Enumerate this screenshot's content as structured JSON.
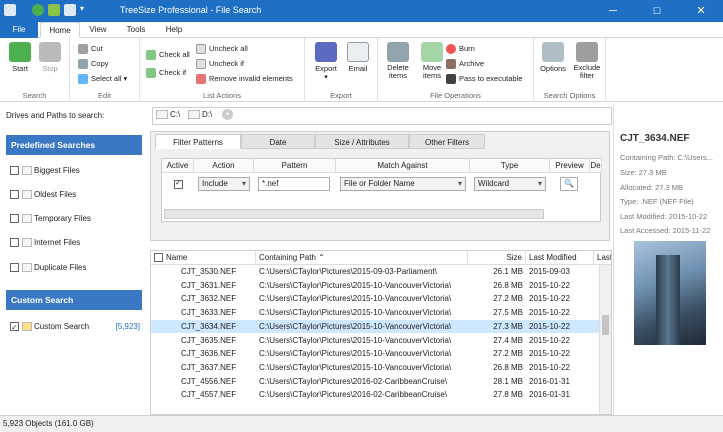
{
  "window": {
    "title": "TreeSize Professional - File Search",
    "min": "─",
    "max": "☐",
    "close": "✕"
  },
  "ribbon_tabs": [
    "File",
    "Home",
    "View",
    "Tools",
    "Help"
  ],
  "ribbon": {
    "search": {
      "start": "Start",
      "stop": "Stop",
      "label": "Search"
    },
    "edit": {
      "cut": "Cut",
      "copy": "Copy",
      "select_all": "Select all ▾",
      "label": "Edit"
    },
    "list_actions": {
      "check_all": "Check all",
      "check_if": "Check if",
      "uncheck_all": "Uncheck all",
      "uncheck_if": "Uncheck if",
      "remove_invalid": "Remove invalid elements",
      "label": "List Actions"
    },
    "export": {
      "export": "Export",
      "email": "Email",
      "label": "Export"
    },
    "file_ops": {
      "delete": "Delete items",
      "move": "Move items",
      "burn": "Burn",
      "archive": "Archive",
      "pass": "Pass to executable",
      "label": "File Operations"
    },
    "search_opts": {
      "options": "Options",
      "exclude": "Exclude filter",
      "label": "Search Options"
    }
  },
  "left": {
    "drives_label": "Drives and Paths to search:",
    "predefined_header": "Predefined Searches",
    "predefined": [
      "Biggest Files",
      "Oldest Files",
      "Temporary Files",
      "Internet Files",
      "Duplicate Files"
    ],
    "custom_header": "Custom Search",
    "custom_item": "Custom Search",
    "custom_count": "[5,923]"
  },
  "drives": [
    "C:\\",
    "D:\\"
  ],
  "filter": {
    "tabs": [
      "Filter Patterns",
      "Date",
      "Size / Attributes",
      "Other Filters"
    ],
    "columns": [
      "Active",
      "Action",
      "Pattern",
      "Match Against",
      "Type",
      "Preview",
      "De"
    ],
    "row": {
      "action": "Include",
      "pattern": "*.nef",
      "match": "File or Folder Name",
      "type": "Wildcard"
    }
  },
  "list": {
    "columns": [
      "Name",
      "Containing Path",
      "Size",
      "Last Modified",
      "Last"
    ],
    "rows": [
      {
        "name": "CJT_3530.NEF",
        "path": "C:\\Users\\CTaylor\\Pictures\\2015-09-03-Parliament\\",
        "size": "26.1 MB",
        "modified": "2015-09-03"
      },
      {
        "name": "CJT_3631.NEF",
        "path": "C:\\Users\\CTaylor\\Pictures\\2015-10-VancouverVictoria\\",
        "size": "26.8 MB",
        "modified": "2015-10-22"
      },
      {
        "name": "CJT_3632.NEF",
        "path": "C:\\Users\\CTaylor\\Pictures\\2015-10-VancouverVictoria\\",
        "size": "27.2 MB",
        "modified": "2015-10-22"
      },
      {
        "name": "CJT_3633.NEF",
        "path": "C:\\Users\\CTaylor\\Pictures\\2015-10-VancouverVictoria\\",
        "size": "27.5 MB",
        "modified": "2015-10-22"
      },
      {
        "name": "CJT_3634.NEF",
        "path": "C:\\Users\\CTaylor\\Pictures\\2015-10-VancouverVictoria\\",
        "size": "27.3 MB",
        "modified": "2015-10-22"
      },
      {
        "name": "CJT_3635.NEF",
        "path": "C:\\Users\\CTaylor\\Pictures\\2015-10-VancouverVictoria\\",
        "size": "27.4 MB",
        "modified": "2015-10-22"
      },
      {
        "name": "CJT_3636.NEF",
        "path": "C:\\Users\\CTaylor\\Pictures\\2015-10-VancouverVictoria\\",
        "size": "27.2 MB",
        "modified": "2015-10-22"
      },
      {
        "name": "CJT_3637.NEF",
        "path": "C:\\Users\\CTaylor\\Pictures\\2015-10-VancouverVictoria\\",
        "size": "26.8 MB",
        "modified": "2015-10-22"
      },
      {
        "name": "CJT_4556.NEF",
        "path": "C:\\Users\\CTaylor\\Pictures\\2016-02-CaribbeanCruise\\",
        "size": "28.1 MB",
        "modified": "2016-01-31"
      },
      {
        "name": "CJT_4557.NEF",
        "path": "C:\\Users\\CTaylor\\Pictures\\2016-02-CaribbeanCruise\\",
        "size": "27.8 MB",
        "modified": "2016-01-31"
      }
    ],
    "selected_row": 4
  },
  "preview": {
    "title": "CJT_3634.NEF",
    "path": "Containing Path: C:\\Users...",
    "size": "Size: 27.3 MB",
    "allocated": "Allocated: 27.3 MB",
    "type": "Type: .NEF (NEF File)",
    "modified": "Last Modified: 2015-10-22",
    "accessed": "Last Accessed: 2015-11-22"
  },
  "status": "5,923 Objects (161.0 GB)",
  "colors": {
    "accent": "#1f6fc5",
    "nav_header": "#3b78c4",
    "selected_row": "#cde8ff"
  }
}
